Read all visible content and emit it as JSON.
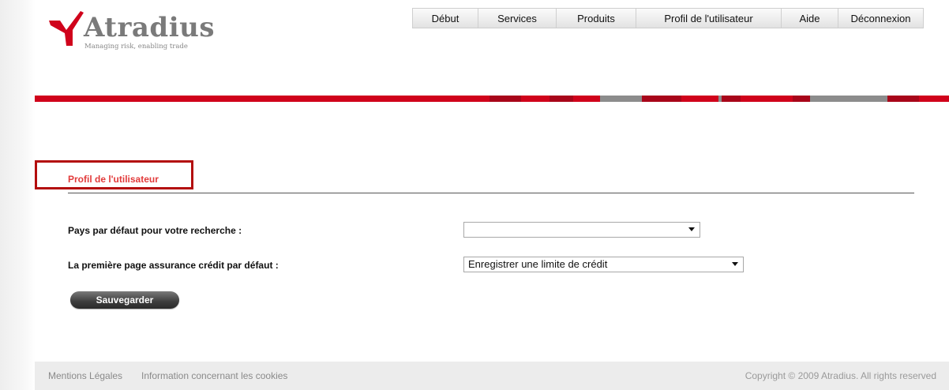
{
  "logo": {
    "word": "Atradius",
    "tagline": "Managing risk, enabling trade"
  },
  "nav": {
    "items": [
      "Début",
      "Services",
      "Produits",
      "Profil de l'utilisateur",
      "Aide",
      "Déconnexion"
    ]
  },
  "colors": {
    "brand_red": "#d0021b",
    "tab_border": "#b30d0d",
    "tab_label": "#e23b3b"
  },
  "profile": {
    "tab_label": "Profil de l'utilisateur",
    "country_label": "Pays par défaut pour votre recherche :",
    "country_value": "",
    "firstpage_label": "La première page assurance crédit par défaut :",
    "firstpage_value": "Enregistrer une limite de crédit",
    "save_label": "Sauvegarder"
  },
  "footer": {
    "legal_label": "Mentions Légales",
    "cookies_label": "Information concernant les cookies",
    "copyright": "Copyright © 2009 Atradius. All rights reserved"
  }
}
